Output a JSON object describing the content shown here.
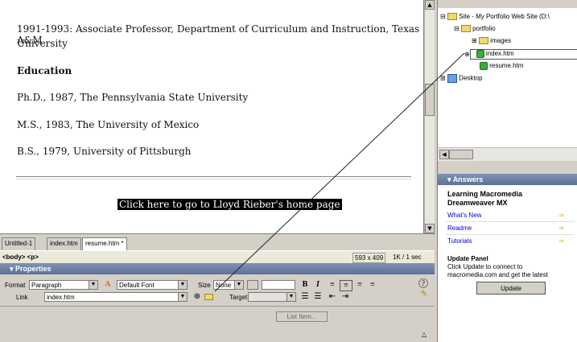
{
  "document": {
    "line1": "1991-1993: Associate Professor, Department of Curriculum and Instruction, Texas A&M",
    "line2": "University",
    "heading": "Education",
    "phd": "Ph.D., 1987, The Pennsylvania State University",
    "ms": "M.S., 1983, The University of Mexico",
    "bs": "B.S., 1979, University of Pittsburgh",
    "link_text": "Click here to go to Lloyd Rieber's home page"
  },
  "tabs": [
    "Untitled-1",
    "index.htm",
    "resume.htm *"
  ],
  "status": {
    "tag": "<body> <p>",
    "size": "593 x 409",
    "weight": "1K / 1 sec"
  },
  "properties": {
    "title": "Properties",
    "format_label": "Format",
    "format_value": "Paragraph",
    "font_value": "Default Font",
    "size_label": "Size",
    "size_value": "None",
    "link_label": "Link",
    "link_value": "index.htm",
    "target_label": "Target",
    "list_item": "List Item..."
  },
  "site": {
    "root": "Site - My Portfolio Web Site (D:\\",
    "portfolio": "portfolio",
    "images": "images",
    "index": "index.htm",
    "resume": "resume.htm",
    "desktop": "Desktop"
  },
  "answers": {
    "title": "Answers",
    "learning1": "Learning Macromedia",
    "learning2": "Dreamweaver MX",
    "whats_new": "What's New",
    "readme": "Readme",
    "tutorials": "Tutorials",
    "update_title": "Update Panel",
    "update_desc1": "Click Update to connect to",
    "update_desc2": "macromedia.com and get the latest",
    "update_button": "Update"
  },
  "colors": {
    "panel_header": "#5d7198",
    "link_bg": "#000000",
    "link_text": "#0000cc"
  }
}
